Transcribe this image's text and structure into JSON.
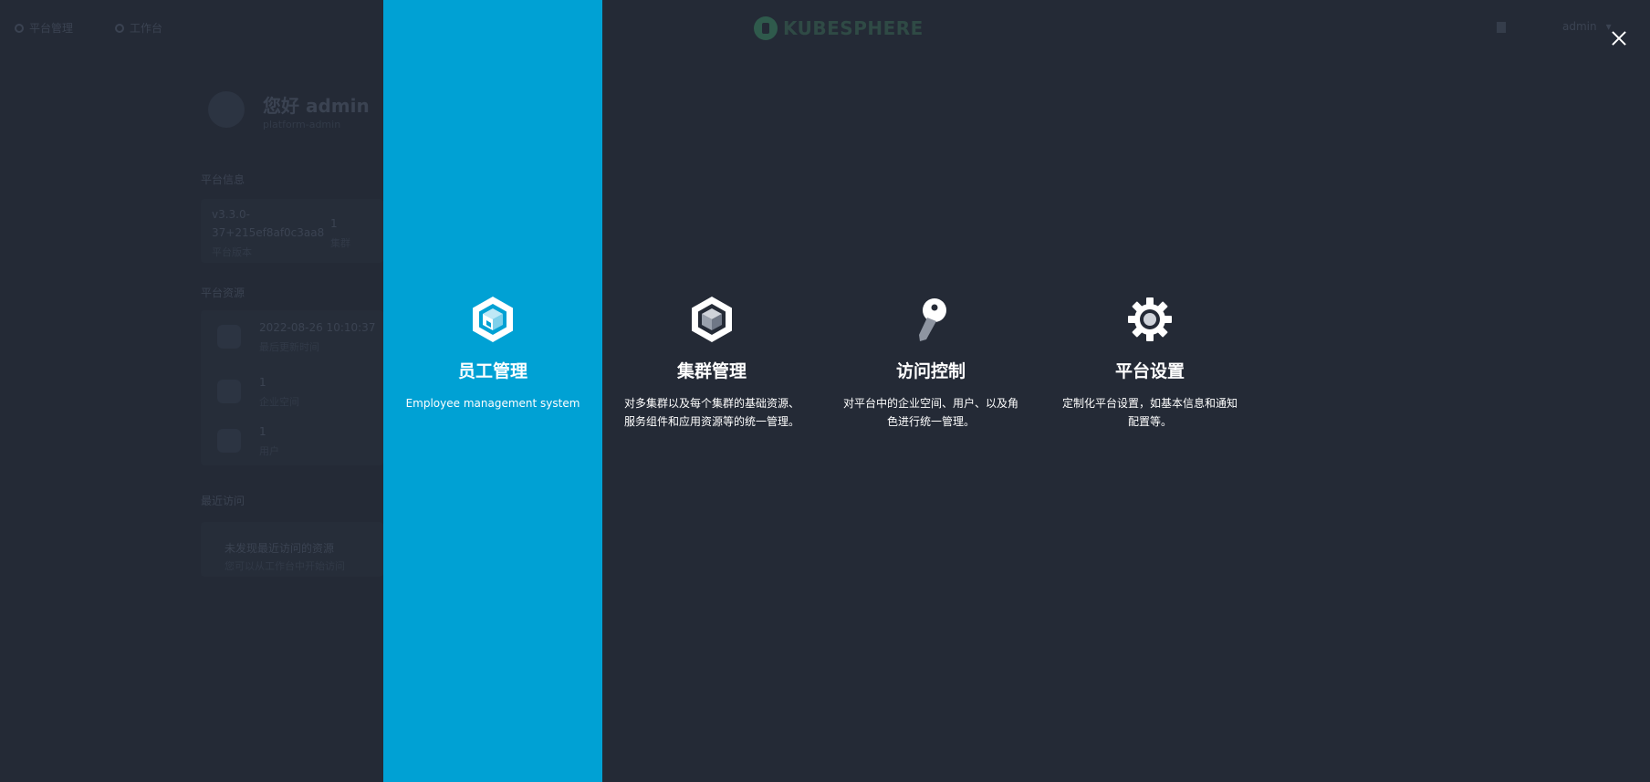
{
  "background": {
    "nav": {
      "platform": "平台管理",
      "workbench": "工作台",
      "logo": "KUBESPHERE",
      "user": "admin"
    },
    "profile": {
      "greeting": "您好 admin",
      "role": "platform-admin"
    },
    "platform_info": {
      "title": "平台信息",
      "version_line1": "v3.3.0-",
      "version_line2": "37+215ef8af0c3aa8",
      "version_label": "平台版本",
      "cluster_count": "1",
      "cluster_label": "集群"
    },
    "platform_resources": {
      "title": "平台资源",
      "time": "2022-08-26 10:10:37",
      "time_label": "最后更新时间",
      "workspace_count": "1",
      "workspace_label": "企业空间",
      "user_count": "1",
      "user_label": "用户"
    },
    "recent": {
      "title": "最近访问",
      "empty_title": "未发现最近访问的资源",
      "empty_desc": "您可以从工作台中开始访问"
    }
  },
  "modal": {
    "tiles": [
      {
        "title": "员工管理",
        "desc": "Employee management system",
        "icon": "cluster-hexagon-icon",
        "active": true
      },
      {
        "title": "集群管理",
        "desc": "对多集群以及每个集群的基础资源、服务组件和应用资源等的统一管理。",
        "icon": "cube-hexagon-icon",
        "active": false
      },
      {
        "title": "访问控制",
        "desc": "对平台中的企业空间、用户、以及角色进行统一管理。",
        "icon": "key-icon",
        "active": false
      },
      {
        "title": "平台设置",
        "desc": "定制化平台设置，如基本信息和通知配置等。",
        "icon": "gear-icon",
        "active": false
      }
    ],
    "colors": {
      "active_tile": "#00a1d4",
      "overlay": "#242a36",
      "text": "#ffffff"
    }
  }
}
